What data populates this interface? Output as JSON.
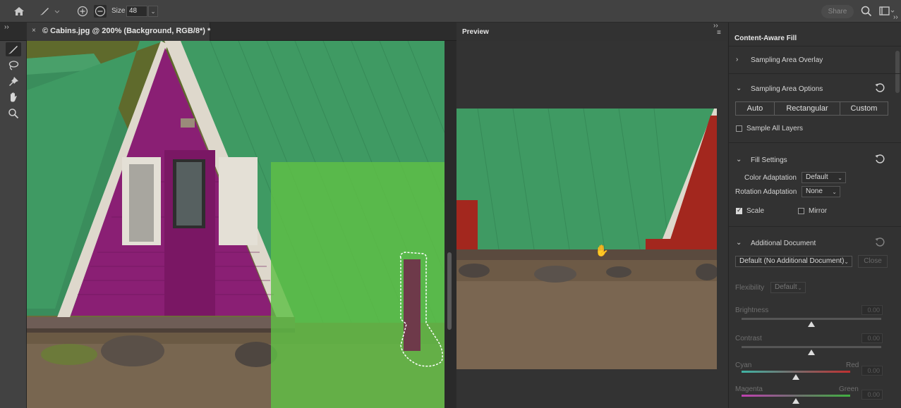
{
  "options_bar": {
    "size_label": "Size",
    "size_value": "48",
    "share_label": "Share"
  },
  "document_tab": {
    "close_glyph": "×",
    "title": "© Cabins.jpg @ 200% (Background, RGB/8*) *"
  },
  "preview": {
    "title": "Preview"
  },
  "panel": {
    "title": "Content-Aware Fill",
    "sampling_overlay": {
      "title": "Sampling Area Overlay"
    },
    "sampling_options": {
      "title": "Sampling Area Options",
      "modes": [
        "Auto",
        "Rectangular",
        "Custom"
      ],
      "sample_all_layers": "Sample All Layers",
      "sample_all_layers_checked": false
    },
    "fill_settings": {
      "title": "Fill Settings",
      "color_adaptation_label": "Color Adaptation",
      "color_adaptation_value": "Default",
      "rotation_adaptation_label": "Rotation Adaptation",
      "rotation_adaptation_value": "None",
      "scale_label": "Scale",
      "scale_checked": true,
      "mirror_label": "Mirror",
      "mirror_checked": false
    },
    "additional_document": {
      "title": "Additional Document",
      "document_value": "Default (No Additional Document)",
      "close_label": "Close",
      "flexibility_label": "Flexibility",
      "flexibility_value": "Default",
      "brightness_label": "Brightness",
      "brightness_value": "0.00",
      "contrast_label": "Contrast",
      "contrast_value": "0.00",
      "cyan_label": "Cyan",
      "red_label": "Red",
      "cyan_red_value": "0.00",
      "magenta_label": "Magenta",
      "green_label": "Green",
      "magenta_green_value": "0.00"
    }
  },
  "colors": {
    "roof_green": "#3f9a63",
    "cabin_purple": "#8a1f74",
    "overlay_green": "#5fbf45",
    "cabin_red": "#a3271e"
  }
}
